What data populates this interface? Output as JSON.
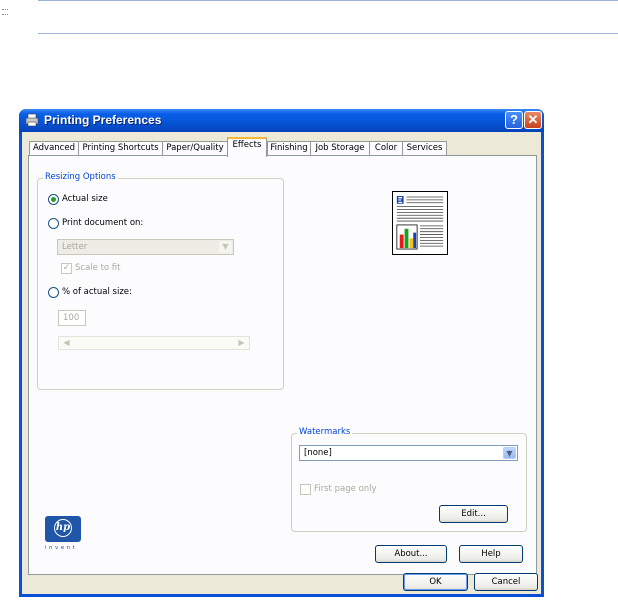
{
  "window": {
    "title": "Printing Preferences",
    "help_btn": "?",
    "close_btn": "✕"
  },
  "tabs": [
    {
      "label": "Advanced",
      "active": false
    },
    {
      "label": "Printing Shortcuts",
      "active": false
    },
    {
      "label": "Paper/Quality",
      "active": false
    },
    {
      "label": "Effects",
      "active": true
    },
    {
      "label": "Finishing",
      "active": false
    },
    {
      "label": "Job Storage",
      "active": false
    },
    {
      "label": "Color",
      "active": false
    },
    {
      "label": "Services",
      "active": false
    }
  ],
  "resizing": {
    "legend": "Resizing Options",
    "actual_size": {
      "label": "Actual size",
      "checked": true
    },
    "print_doc_on": {
      "label": "Print document on:",
      "checked": false
    },
    "paper_select": {
      "value": "Letter",
      "enabled": false
    },
    "scale_to_fit": {
      "label": "Scale to fit",
      "checked": true,
      "enabled": false
    },
    "percent": {
      "label": "% of actual size:",
      "checked": false
    },
    "percent_value": "100"
  },
  "watermarks": {
    "legend": "Watermarks",
    "select_value": "[none]",
    "first_page_only": {
      "label": "First page only",
      "checked": false,
      "enabled": false
    },
    "edit_label": "Edit..."
  },
  "logo": {
    "brand": "hp",
    "tagline": "invent"
  },
  "buttons": {
    "about": "About...",
    "help": "Help",
    "ok": "OK",
    "cancel": "Cancel"
  },
  "colors": {
    "titlebar": "#0654d6",
    "dialog_bg": "#ece9d8",
    "legend_blue": "#0046d5",
    "active_tab_accent": "#f9b934",
    "radio_check": "#21a121"
  }
}
